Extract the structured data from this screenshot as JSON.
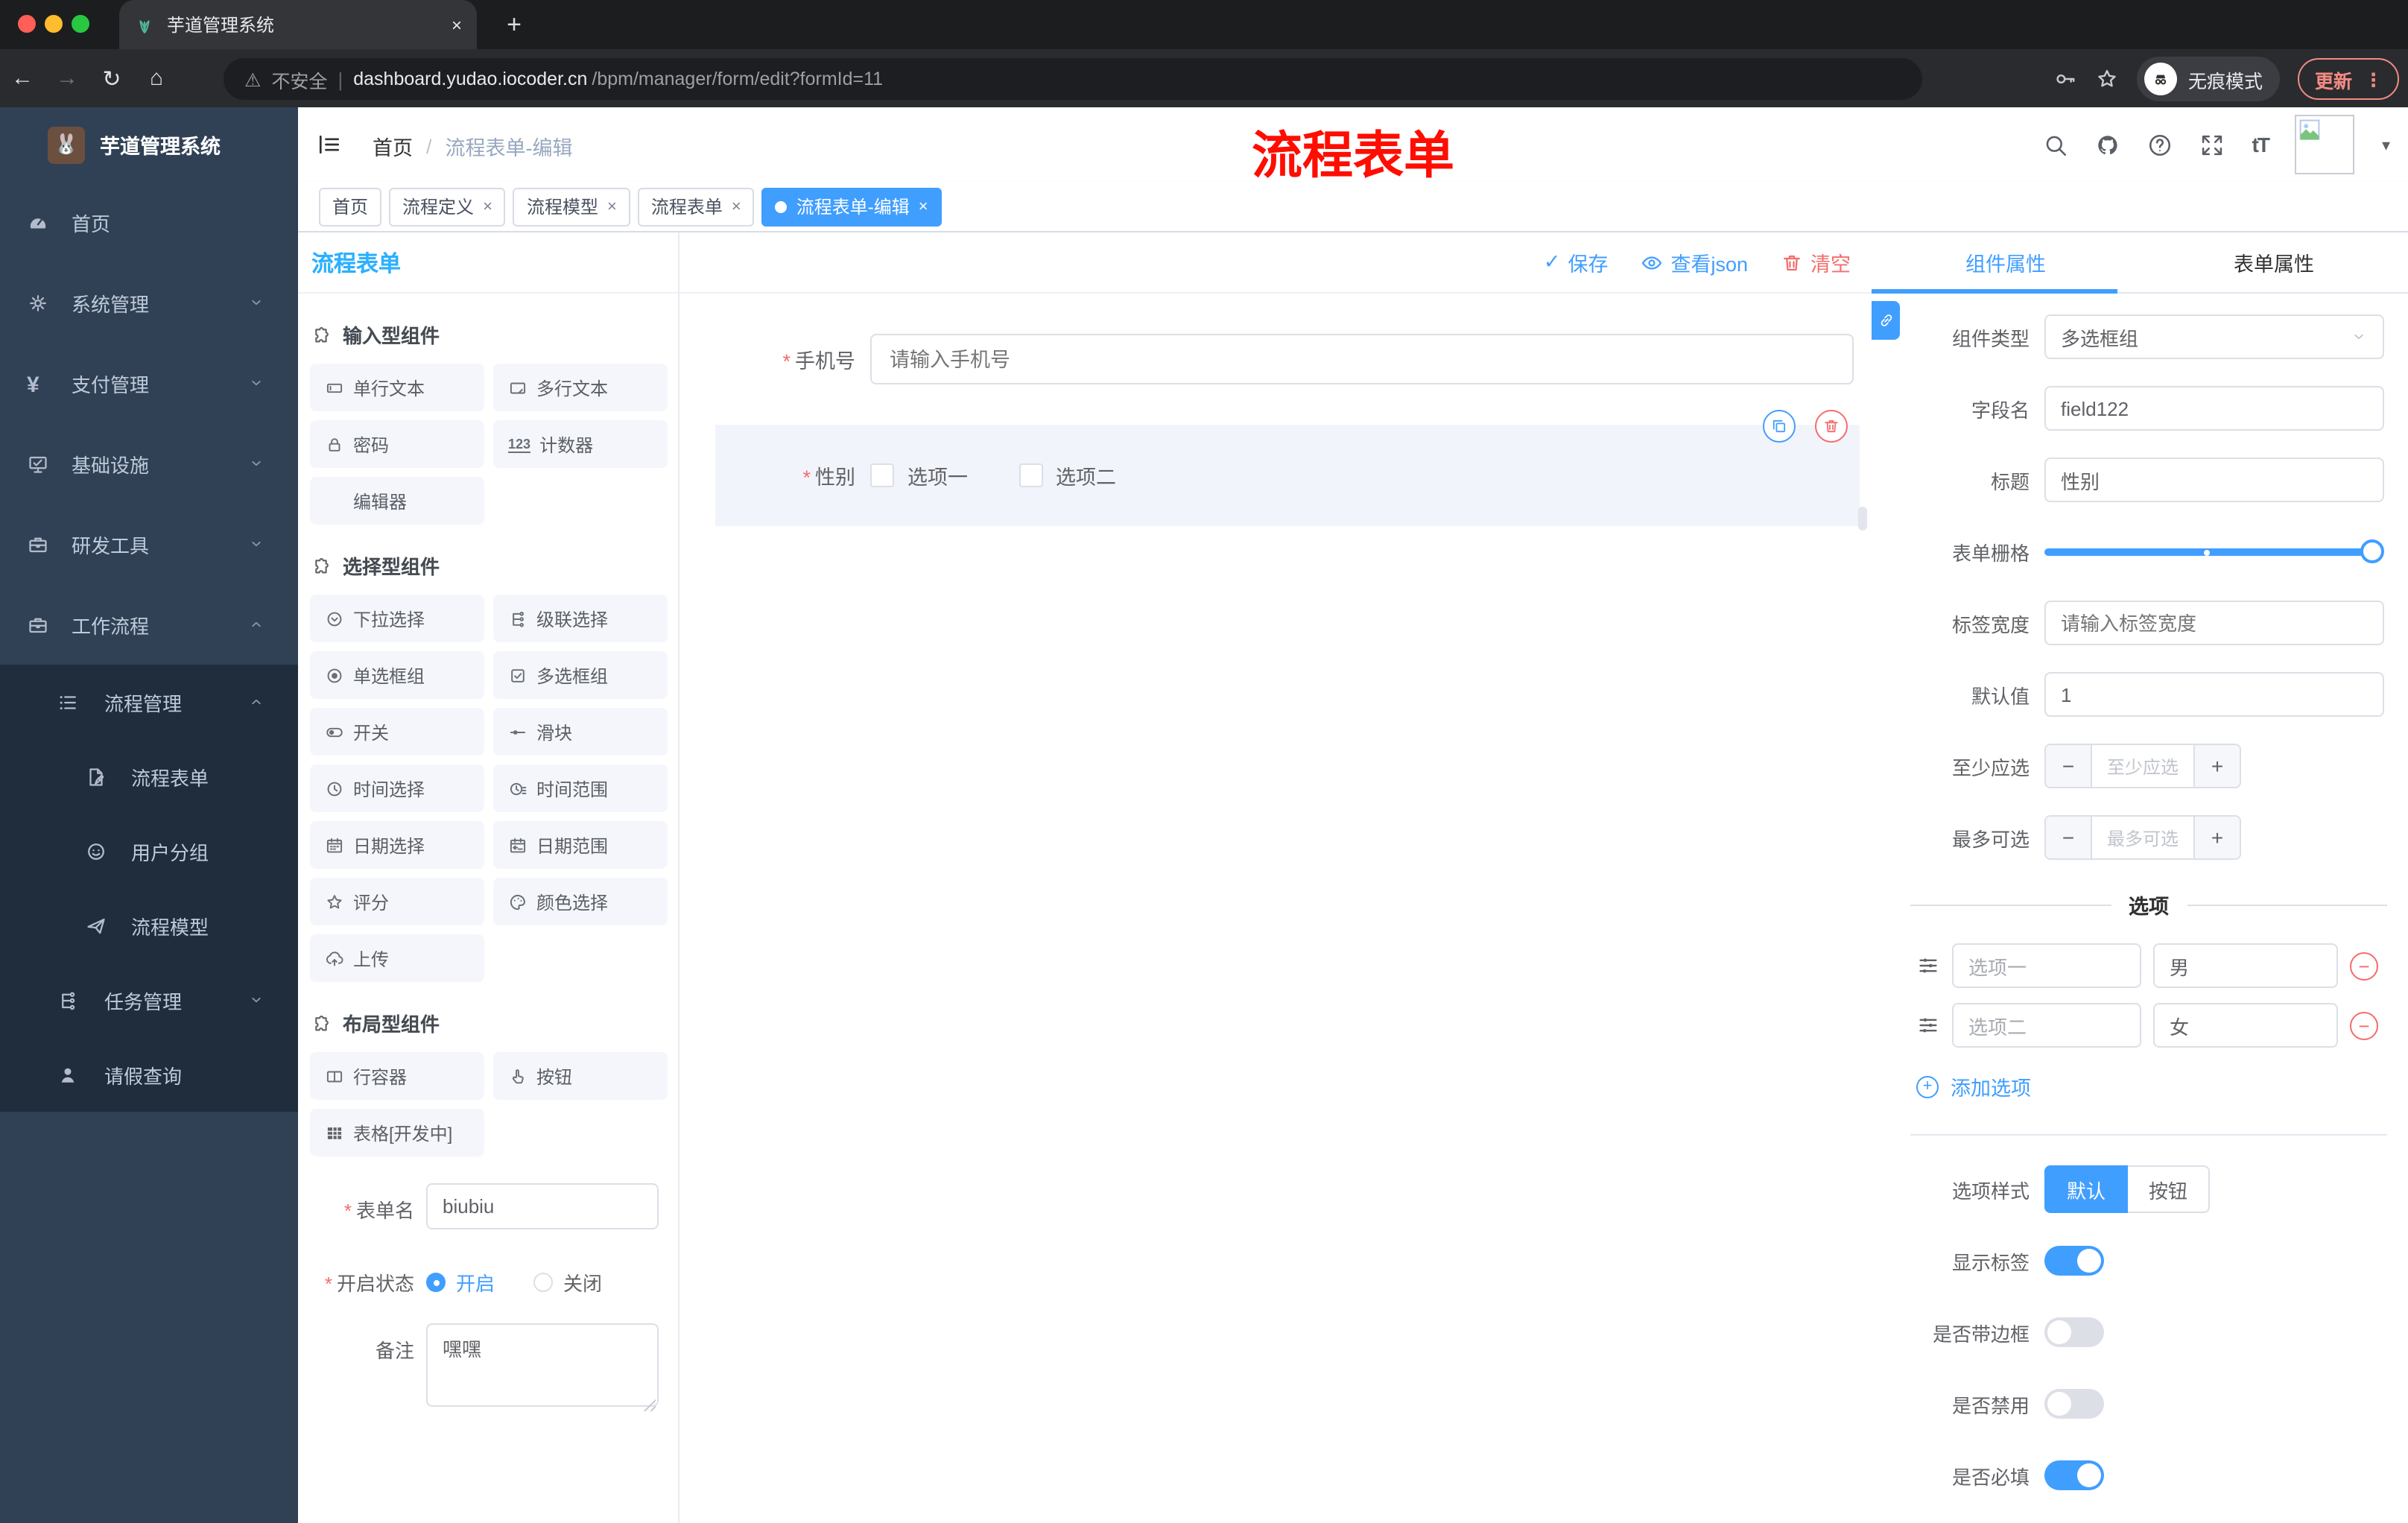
{
  "browser": {
    "tab": {
      "title": "芋道管理系统"
    },
    "address": {
      "security": "不安全",
      "host": "dashboard.yudao.iocoder.cn",
      "path": "/bpm/manager/form/edit?formId=11"
    },
    "incognito": "无痕模式",
    "update": "更新"
  },
  "annotation": "流程表单",
  "icons": {
    "back": "←",
    "forward": "→",
    "reload": "↻",
    "home": "⌂",
    "warning": "⚠",
    "more": "⋮",
    "caret_down": "▾",
    "close": "×",
    "new_tab": "+",
    "check": "✓",
    "star": "☆",
    "minus": "−",
    "plus": "+",
    "divider": "|",
    "fontsize": "tT",
    "counter": "123"
  },
  "sidebar": {
    "logo": "芋道管理系统",
    "items": [
      {
        "label": "首页"
      },
      {
        "label": "系统管理"
      },
      {
        "label": "支付管理"
      },
      {
        "label": "基础设施"
      },
      {
        "label": "研发工具"
      },
      {
        "label": "工作流程"
      },
      {
        "label": "流程管理"
      },
      {
        "label": "流程表单"
      },
      {
        "label": "用户分组"
      },
      {
        "label": "流程模型"
      },
      {
        "label": "任务管理"
      },
      {
        "label": "请假查询"
      }
    ]
  },
  "header": {
    "breadcrumb_home": "首页",
    "breadcrumb_current": "流程表单-编辑"
  },
  "tags": [
    {
      "label": "首页"
    },
    {
      "label": "流程定义"
    },
    {
      "label": "流程模型"
    },
    {
      "label": "流程表单"
    },
    {
      "label": "流程表单-编辑"
    }
  ],
  "designer": {
    "title": "流程表单",
    "toolbar": {
      "save": "保存",
      "view_json": "查看json",
      "clear": "清空"
    },
    "sections": [
      {
        "title": "输入型组件",
        "items": [
          "单行文本",
          "多行文本",
          "密码",
          "计数器",
          "编辑器"
        ]
      },
      {
        "title": "选择型组件",
        "items": [
          "下拉选择",
          "级联选择",
          "单选框组",
          "多选框组",
          "开关",
          "滑块",
          "时间选择",
          "时间范围",
          "日期选择",
          "日期范围",
          "评分",
          "颜色选择",
          "上传"
        ]
      },
      {
        "title": "布局型组件",
        "items": [
          "行容器",
          "按钮",
          "表格[开发中]"
        ]
      }
    ],
    "meta": {
      "name_label": "表单名",
      "name_value": "biubiu",
      "status_label": "开启状态",
      "status_on": "开启",
      "status_off": "关闭",
      "remark_label": "备注",
      "remark_value": "嘿嘿"
    }
  },
  "canvas": {
    "phone": {
      "label": "手机号",
      "placeholder": "请输入手机号"
    },
    "gender": {
      "label": "性别",
      "options": [
        "选项一",
        "选项二"
      ]
    }
  },
  "inspector": {
    "tab_component": "组件属性",
    "tab_form": "表单属性",
    "rows": {
      "type_label": "组件类型",
      "type_value": "多选框组",
      "field_label": "字段名",
      "field_value": "field122",
      "title_label": "标题",
      "title_value": "性别",
      "grid_label": "表单栅格",
      "labelw_label": "标签宽度",
      "labelw_placeholder": "请输入标签宽度",
      "default_label": "默认值",
      "default_value": "1",
      "min_label": "至少应选",
      "min_placeholder": "至少应选",
      "max_label": "最多可选",
      "max_placeholder": "最多可选"
    },
    "options_title": "选项",
    "options": [
      {
        "label": "选项一",
        "value": "男"
      },
      {
        "label": "选项二",
        "value": "女"
      }
    ],
    "add_option": "添加选项",
    "style": {
      "label": "选项样式",
      "opt_default": "默认",
      "opt_button": "按钮"
    },
    "switches": [
      {
        "label": "显示标签",
        "state": "on"
      },
      {
        "label": "是否带边框",
        "state": "off"
      },
      {
        "label": "是否禁用",
        "state": "off"
      },
      {
        "label": "是否必填",
        "state": "on"
      }
    ]
  },
  "colors": {
    "primary": "#409eff",
    "danger": "#f56c6c",
    "title_blue": "#2db0ff",
    "annotation_red": "#ff0d00",
    "sidebar_bg": "#304156",
    "submenu_bg": "#1f2d3d"
  }
}
